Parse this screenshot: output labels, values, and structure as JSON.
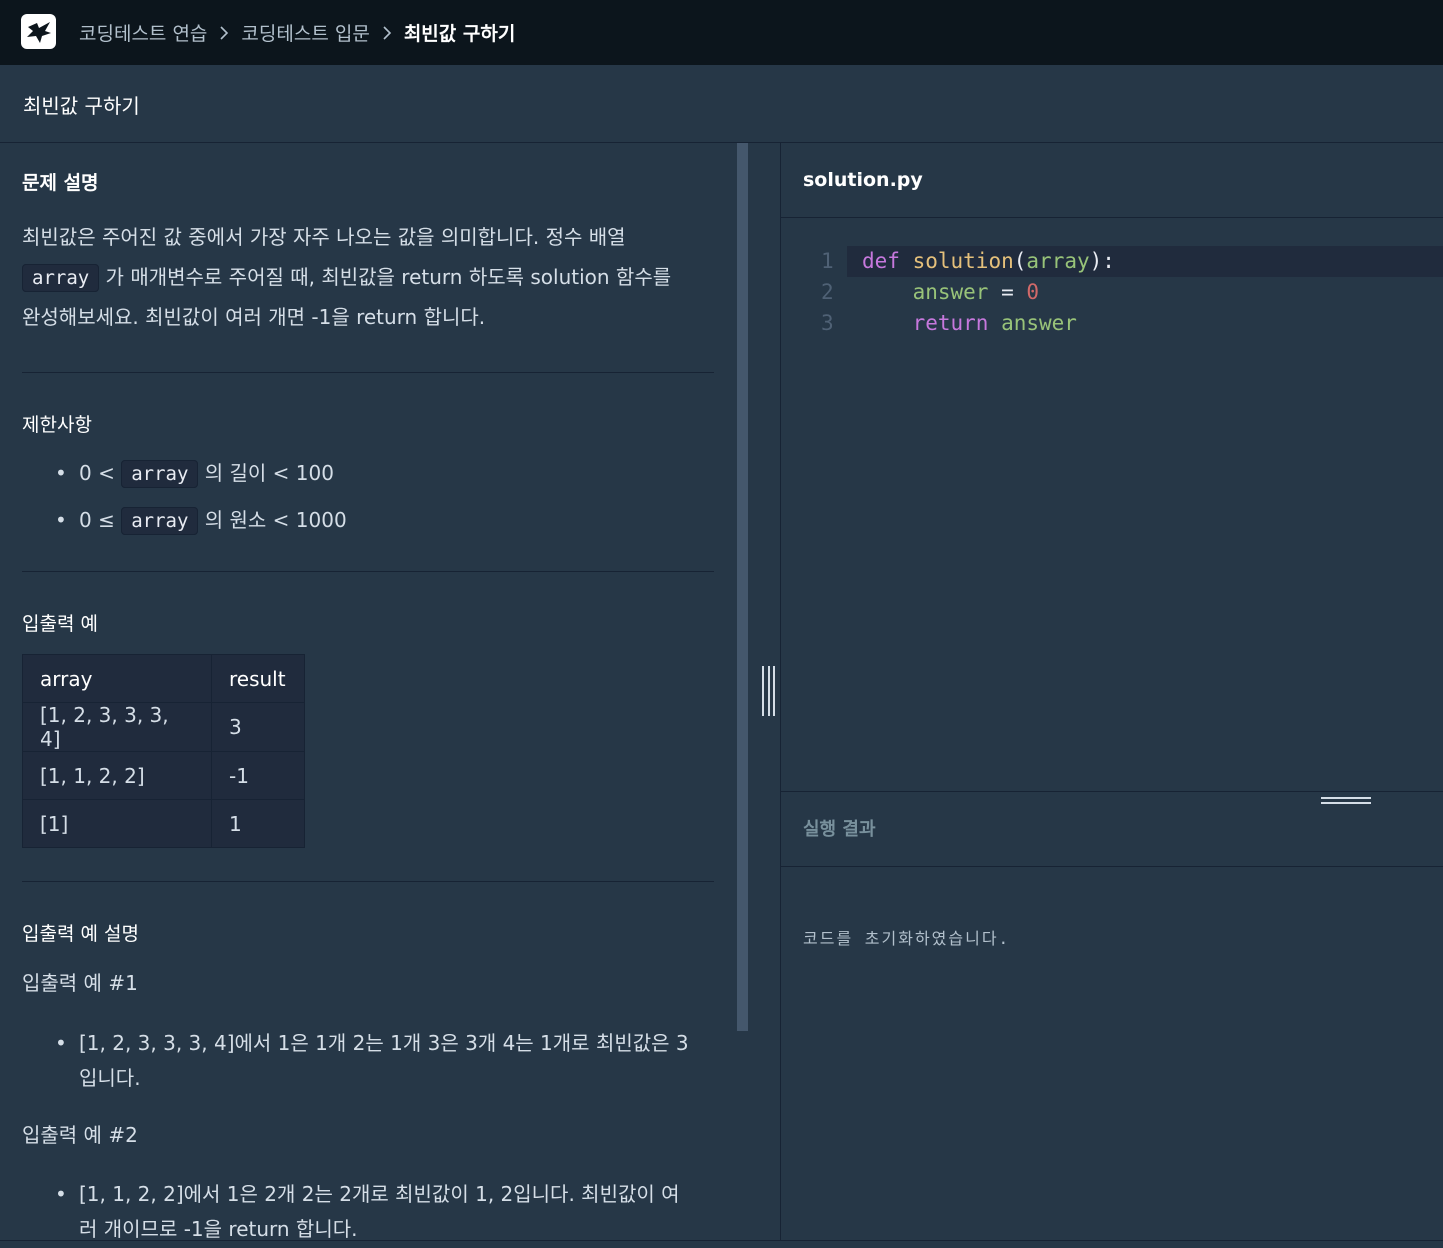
{
  "breadcrumb": {
    "items": [
      "코딩테스트 연습",
      "코딩테스트 입문",
      "최빈값 구하기"
    ]
  },
  "page_title": "최빈값 구하기",
  "description": {
    "heading": "문제 설명",
    "line1": "최빈값은 주어진 값 중에서 가장 자주 나오는 값을 의미합니다. 정수 배열",
    "line2_code": "array",
    "line2_rest": " 가 매개변수로 주어질 때, 최빈값을 return 하도록 solution 함수를",
    "line3": "완성해보세요. 최빈값이 여러 개면 -1을 return 합니다."
  },
  "constraints": {
    "heading": "제한사항",
    "items": [
      {
        "before": "0 < ",
        "code": "array",
        "after": " 의 길이 < 100"
      },
      {
        "before": "0 ≤ ",
        "code": "array",
        "after": " 의 원소 < 1000"
      }
    ]
  },
  "examples": {
    "heading": "입출력 예",
    "columns": [
      "array",
      "result"
    ],
    "rows": [
      [
        "[1, 2, 3, 3, 3, 4]",
        "3"
      ],
      [
        "[1, 1, 2, 2]",
        "-1"
      ],
      [
        "[1]",
        "1"
      ]
    ]
  },
  "explanation": {
    "heading": "입출력 예 설명",
    "ex1_title": "입출력 예 #1",
    "ex1_line1": "[1, 2, 3, 3, 3, 4]에서 1은 1개 2는 1개 3은 3개 4는 1개로 최빈값은 3",
    "ex1_line2": "입니다.",
    "ex2_title": "입출력 예 #2",
    "ex2_line1": "[1, 1, 2, 2]에서 1은 2개 2는 2개로 최빈값이 1, 2입니다. 최빈값이 여",
    "ex2_line2": "러 개이므로 -1을 return 합니다."
  },
  "editor": {
    "filename": "solution.py",
    "line_numbers": [
      "1",
      "2",
      "3"
    ],
    "code": {
      "l1_def": "def",
      "l1_fn": "solution",
      "l1_open": "(",
      "l1_arg": "array",
      "l1_close": "):",
      "l2_var": "answer",
      "l2_eq": " = ",
      "l2_num": "0",
      "l3_kw": "return",
      "l3_var": "answer"
    }
  },
  "result_panel": {
    "label": "실행 결과",
    "output": "코드를 초기화하였습니다."
  },
  "colors": {
    "topbar": "#0c151c",
    "panel": "#263747",
    "code_bg": "#202b3d",
    "keyword": "#c678dd",
    "function": "#e5c07b",
    "identifier": "#98c379",
    "number": "#d16969"
  }
}
